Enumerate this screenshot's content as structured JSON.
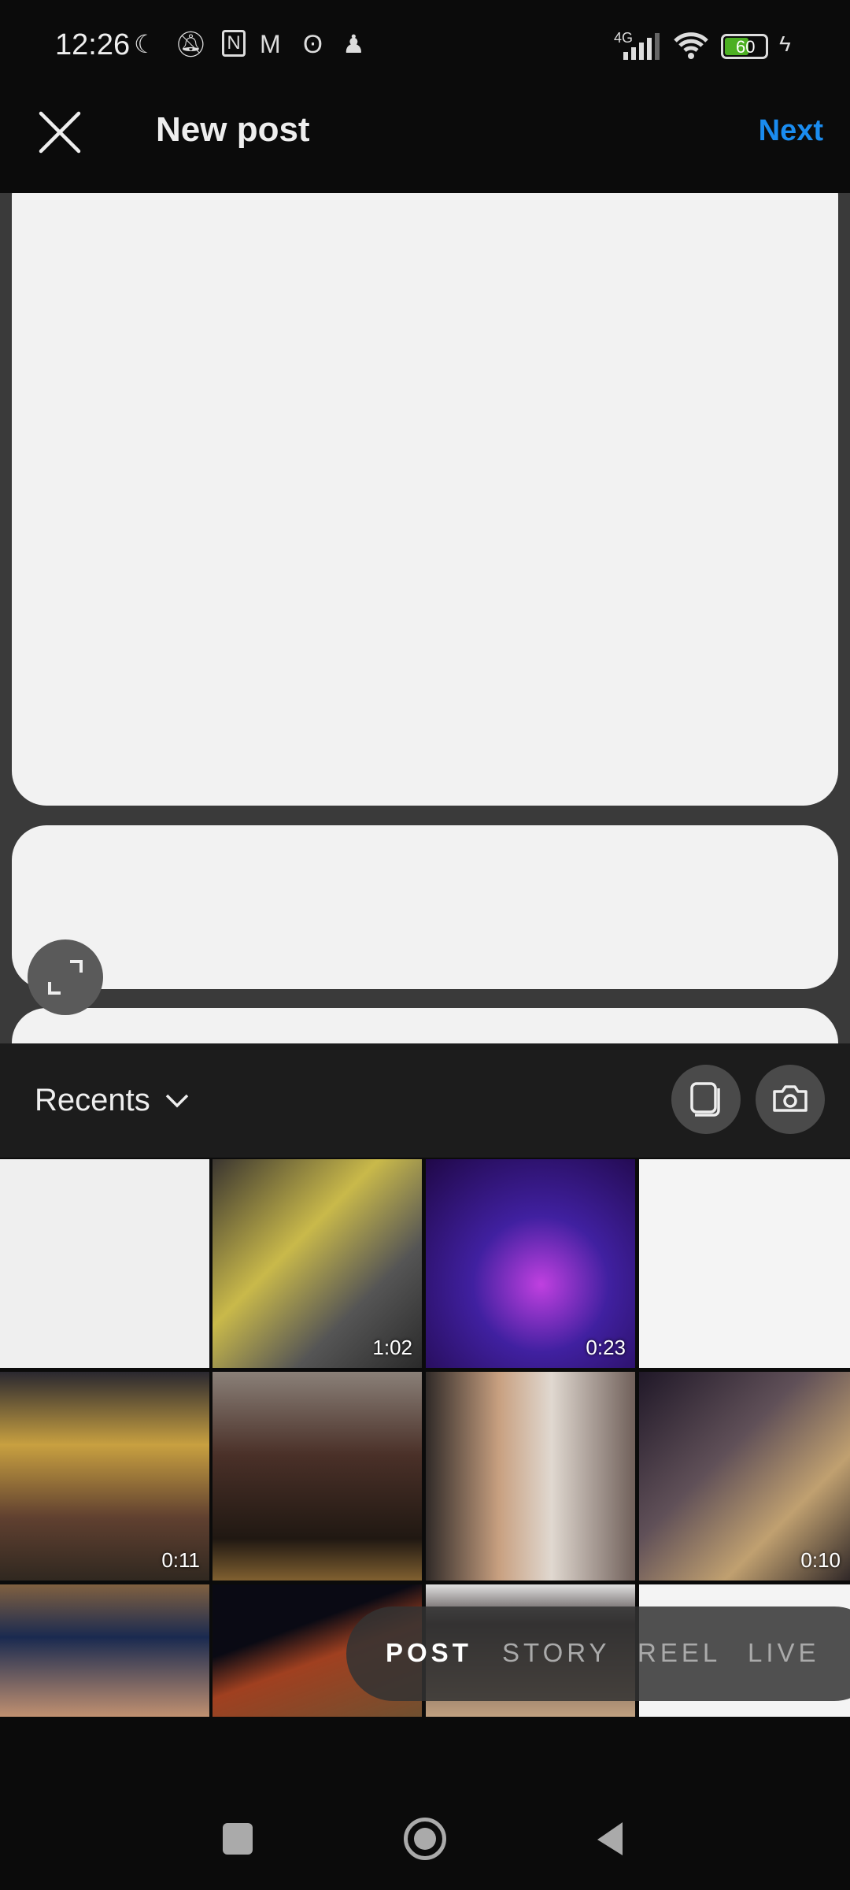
{
  "status_bar": {
    "time": "12:26",
    "network": "4G",
    "battery": "60",
    "icons": [
      "moon-icon",
      "bell-off-icon",
      "nfc-icon",
      "gmail-icon",
      "app-icon",
      "chess-pawn-icon",
      "signal-icon",
      "wifi-icon",
      "battery-icon",
      "charging-icon"
    ]
  },
  "header": {
    "title": "New post",
    "next_label": "Next",
    "close_icon": "close-icon"
  },
  "gallery": {
    "album_label": "Recents",
    "items": [
      {
        "duration": null
      },
      {
        "duration": "1:02"
      },
      {
        "duration": "0:23"
      },
      {
        "duration": null
      },
      {
        "duration": "0:11"
      },
      {
        "duration": null
      },
      {
        "duration": null
      },
      {
        "duration": "0:10"
      },
      {
        "duration": null
      },
      {
        "duration": null
      },
      {
        "duration": null
      },
      {
        "duration": null
      }
    ]
  },
  "modes": [
    {
      "label": "POST",
      "active": true
    },
    {
      "label": "STORY"
    },
    {
      "label": "REEL"
    },
    {
      "label": "LIVE"
    }
  ],
  "colors": {
    "accent": "#1a8cf0"
  }
}
